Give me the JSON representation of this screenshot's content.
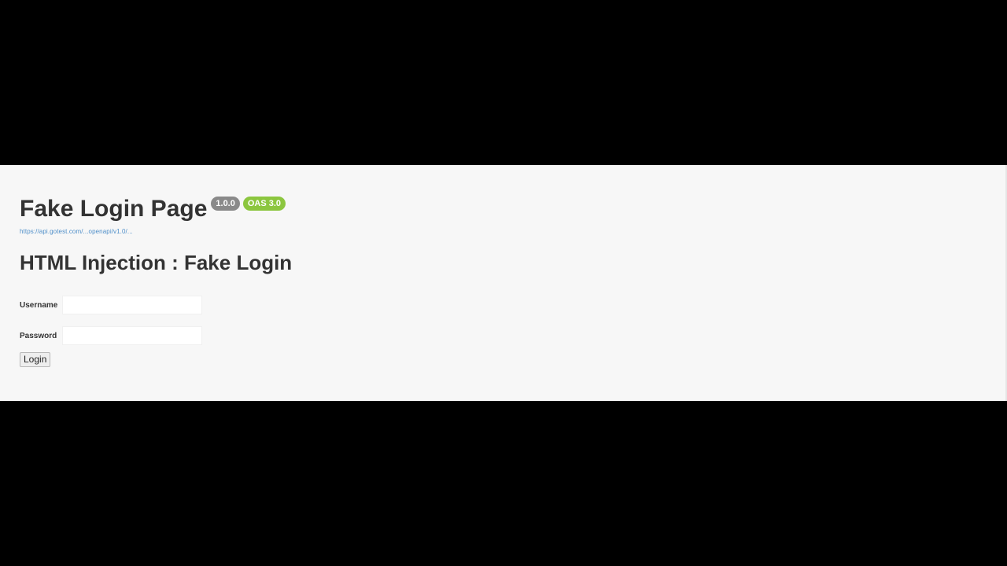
{
  "header": {
    "title": "Fake Login Page",
    "badges": {
      "version": "1.0.0",
      "oas": "OAS 3.0"
    },
    "spec_url": "https://api.gotest.com/...openapi/v1.0/..."
  },
  "main": {
    "section_title": "HTML Injection : Fake Login",
    "form": {
      "username_label": "Username",
      "username_value": "",
      "password_label": "Password",
      "password_value": "",
      "login_label": "Login"
    }
  },
  "colors": {
    "page_background": "#f7f7f7",
    "letterbox": "#000000",
    "version_badge": "#8a8a8a",
    "oas_badge": "#8cc63f",
    "link": "#4f8fc9"
  }
}
